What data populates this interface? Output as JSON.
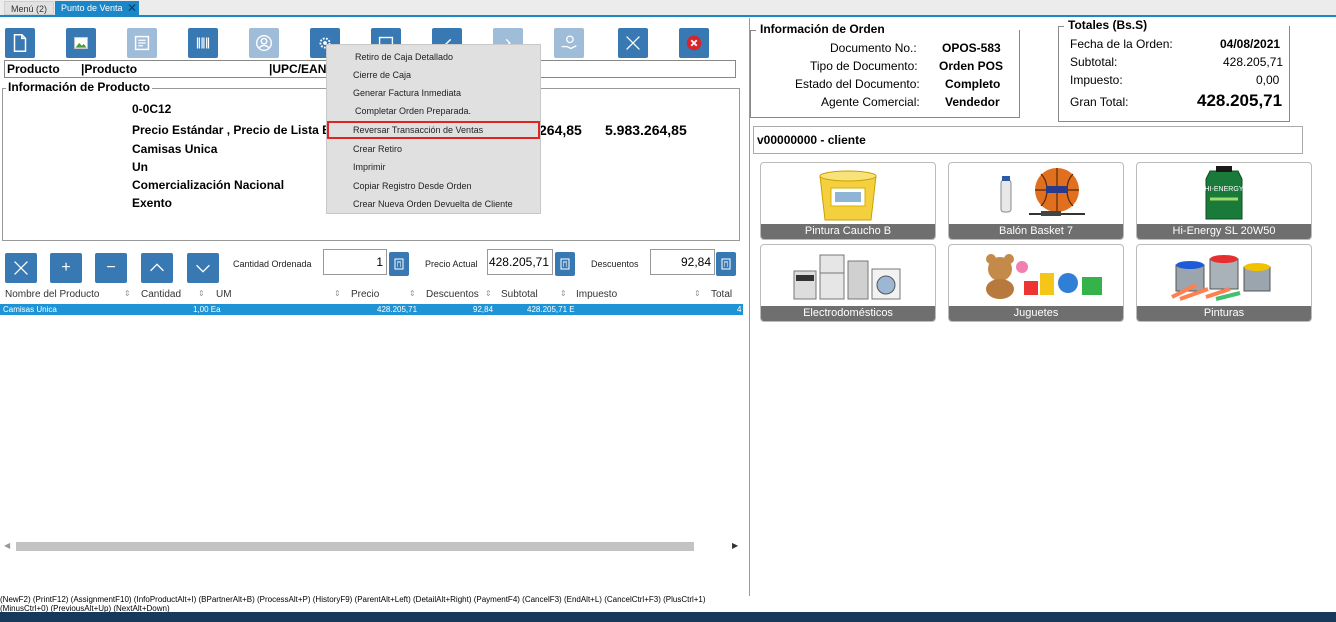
{
  "tabs": [
    {
      "label": "Menú (2)"
    },
    {
      "label": "Punto de Venta"
    }
  ],
  "toolbar": {
    "buttons": [
      "new-document-icon",
      "image-icon",
      "print-icon",
      "barcode-icon",
      "user-icon",
      "gear-icon",
      "calendar-icon",
      "undo-icon",
      "redo-icon",
      "payment-icon",
      "cancel-icon",
      "close-icon"
    ]
  },
  "search": {
    "producto_label": "Producto",
    "producto_value": "|Producto",
    "upc_label": "|UPC/EAN:"
  },
  "product_info": {
    "legend": "Información de Producto",
    "code": "0-0C12",
    "price_label": "Precio Estándar , Precio de Lista Bs.S",
    "price_std": "264,85",
    "price_list": "5.983.264,85",
    "name": "Camisas Unica",
    "uom": "Un",
    "category": "Comercialización Nacional",
    "tax": "Exento"
  },
  "popup_menu": {
    "items": [
      "Retiro de Caja Detallado",
      "Cierre de Caja",
      "Generar Factura Inmediata",
      "Completar Orden Preparada.",
      "Reversar Transacción de Ventas",
      "Crear Retiro",
      "Imprimir",
      "Copiar Registro Desde Orden",
      "Crear Nueva Orden Devuelta de Cliente"
    ],
    "selected": "Reversar Transacción de Ventas"
  },
  "quantity": {
    "cantidad_label": "Cantidad Ordenada",
    "cantidad_value": "1",
    "precio_label": "Precio Actual",
    "precio_value": "428.205,71",
    "descuento_label": "Descuentos",
    "descuento_value": "92,84"
  },
  "table": {
    "headers": [
      "Nombre del Producto",
      "Cantidad",
      "UM",
      "Precio",
      "Descuentos",
      "Subtotal",
      "Impuesto",
      "Total"
    ],
    "rows": [
      {
        "nombre": "Camisas Unica",
        "cantidad": "1,00 Ea",
        "precio": "428.205,71",
        "descuento": "92,84",
        "subtotal": "428.205,71 E",
        "total": "4"
      }
    ]
  },
  "shortcuts": "(NewF2) (PrintF12) (AssignmentF10) (InfoProductAlt+I) (BPartnerAlt+B) (ProcessAlt+P) (HistoryF9) (ParentAlt+Left) (DetailAlt+Right) (PaymentF4) (CancelF3) (EndAlt+L) (CancelCtrl+F3) (PlusCtrl+1) (MinusCtrl+0) (PreviousAlt+Up) (NextAlt+Down)",
  "order_info": {
    "legend": "Información de Orden",
    "doc_label": "Documento No.:",
    "doc_value": "OPOS-583",
    "type_label": "Tipo de Documento:",
    "type_value": "Orden POS",
    "status_label": "Estado del Documento:",
    "status_value": "Completo",
    "agent_label": "Agente Comercial:",
    "agent_value": "Vendedor"
  },
  "totals": {
    "legend": "Totales (Bs.S)",
    "date_label": "Fecha de la Orden:",
    "date_value": "04/08/2021",
    "subtotal_label": "Subtotal:",
    "subtotal_value": "428.205,71",
    "tax_label": "Impuesto:",
    "tax_value": "0,00",
    "grand_label": "Gran Total:",
    "grand_value": "428.205,71"
  },
  "customer": "v00000000 - cliente",
  "products": [
    {
      "label": "Pintura Caucho B",
      "icon": "paint-bucket-icon"
    },
    {
      "label": "Balón Basket 7",
      "icon": "basketball-icon"
    },
    {
      "label": "Hi-Energy SL 20W50",
      "icon": "oil-bottle-icon"
    },
    {
      "label": "Electrodomésticos",
      "icon": "appliances-icon"
    },
    {
      "label": "Juguetes",
      "icon": "toys-icon"
    },
    {
      "label": "Pinturas",
      "icon": "paint-cans-icon"
    }
  ],
  "colors": {
    "accent": "#1b87c9",
    "button": "#3879b4",
    "selection": "#1e94d6",
    "highlight_border": "#e02424",
    "close_red": "#d9252a"
  }
}
